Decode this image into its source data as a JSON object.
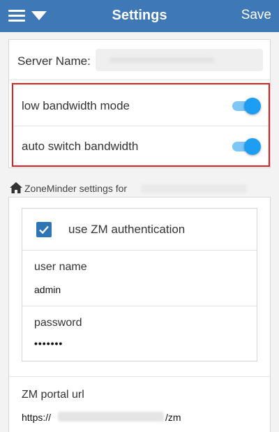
{
  "header": {
    "title": "Settings",
    "save_label": "Save"
  },
  "server": {
    "label": "Server Name:"
  },
  "bandwidth": {
    "low_label": "low bandwidth mode",
    "low_enabled": true,
    "auto_label": "auto switch bandwidth",
    "auto_enabled": true
  },
  "zm": {
    "section_label": "ZoneMinder settings for",
    "auth_label": "use ZM authentication",
    "auth_checked": true,
    "username_label": "user name",
    "username_value": "admin",
    "password_label": "password",
    "password_value": "•••••••",
    "portal_label": "ZM portal url",
    "portal_prefix": "https://",
    "portal_suffix": "/zm"
  },
  "colors": {
    "header_bg": "#3f78b6",
    "toggle_on": "#1e9ef2",
    "highlight": "#e02020",
    "checkbox": "#2f74b5"
  }
}
